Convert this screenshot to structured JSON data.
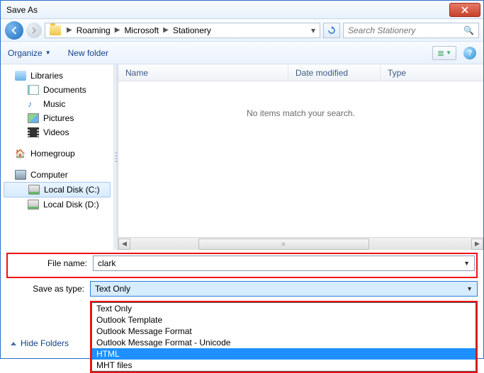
{
  "window": {
    "title": "Save As"
  },
  "breadcrumb": {
    "segments": [
      "Roaming",
      "Microsoft",
      "Stationery"
    ]
  },
  "search": {
    "placeholder": "Search Stationery"
  },
  "toolbar": {
    "organize": "Organize",
    "newfolder": "New folder"
  },
  "sidebar": {
    "libraries": "Libraries",
    "documents": "Documents",
    "music": "Music",
    "pictures": "Pictures",
    "videos": "Videos",
    "homegroup": "Homegroup",
    "computer": "Computer",
    "localc": "Local Disk (C:)",
    "locald": "Local Disk (D:)"
  },
  "columns": {
    "name": "Name",
    "date": "Date modified",
    "type": "Type"
  },
  "list": {
    "empty": "No items match your search."
  },
  "form": {
    "filename_label": "File name:",
    "filename_value": "clark",
    "saveastype_label": "Save as type:",
    "saveastype_value": "Text Only",
    "options": [
      "Text Only",
      "Outlook Template",
      "Outlook Message Format",
      "Outlook Message Format - Unicode",
      "HTML",
      "MHT files"
    ],
    "selected_option": "HTML"
  },
  "footer": {
    "hidefolders": "Hide Folders"
  }
}
